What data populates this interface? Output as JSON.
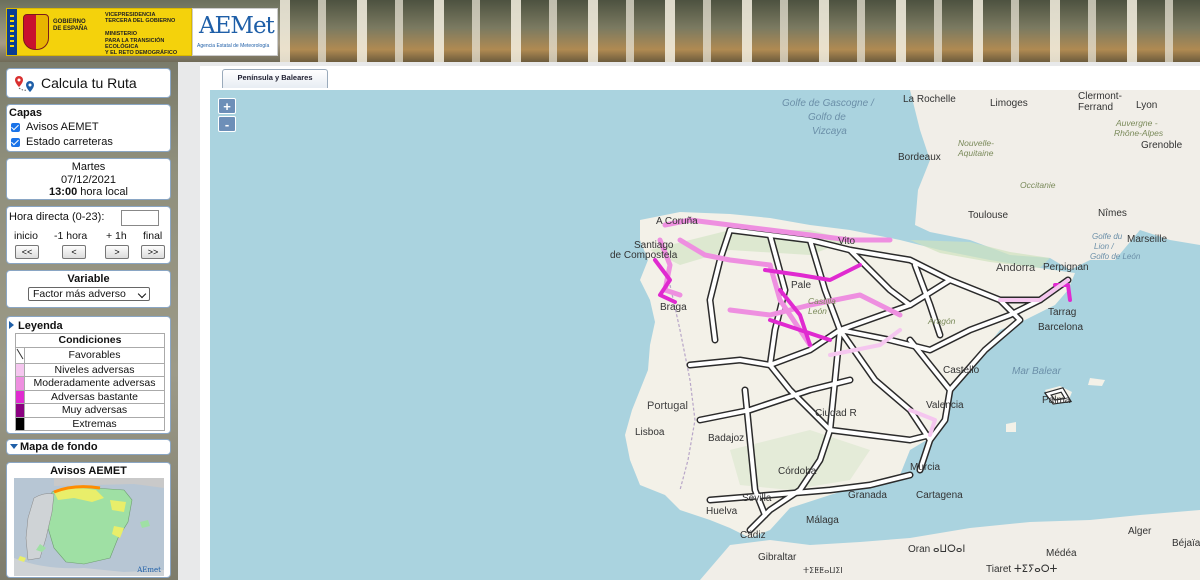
{
  "header": {
    "gov_text": "GOBIERNO\nDE ESPAÑA",
    "ministry_text": "VICEPRESIDENCIA\nTERCERA DEL GOBIERNO\n\nMINISTERIO\nPARA LA TRANSICIÓN ECOLÓGICA\nY EL RETO DEMOGRÁFICO",
    "aemet_logo": "AEMet",
    "aemet_subtitle": "Agencia Estatal de Meteorología"
  },
  "sidebar": {
    "route_title": "Calcula tu Ruta",
    "layers": {
      "title": "Capas",
      "items": [
        {
          "label": "Avisos AEMET",
          "checked": true
        },
        {
          "label": "Estado carreteras",
          "checked": true
        }
      ]
    },
    "date": {
      "day": "Martes",
      "date": "07/12/2021",
      "time": "13:00",
      "time_suffix": " hora local"
    },
    "time_nav": {
      "label": "Hora directa (0-23):",
      "input_value": "",
      "labels": [
        "inicio",
        "-1 hora",
        "+ 1h",
        "final"
      ],
      "buttons": [
        "<<",
        "<",
        ">",
        ">>"
      ]
    },
    "variable": {
      "title": "Variable",
      "selected": "Factor más adverso"
    },
    "legend": {
      "title": "Leyenda",
      "header": "Condiciones",
      "rows": [
        {
          "label": "Favorables",
          "color": "#ffffff"
        },
        {
          "label": "Niveles adversas",
          "color": "#f5c6ef"
        },
        {
          "label": "Moderadamente adversas",
          "color": "#ee8fe0"
        },
        {
          "label": "Adversas bastante",
          "color": "#e02ad0"
        },
        {
          "label": "Muy adversas",
          "color": "#8a0080"
        },
        {
          "label": "Extremas",
          "color": "#000000"
        }
      ]
    },
    "basemap_title": "Mapa de fondo",
    "avisos_title": "Avisos AEMET",
    "avisos_brand": "AEmet"
  },
  "main": {
    "tab_label": "Península y Baleares",
    "zoom_in": "+",
    "zoom_out": "-",
    "map_labels": {
      "gascogne": "Golfe de Gascogne /",
      "golfo": "Golfo de",
      "vizcaya": "Vizcaya",
      "la_rochelle": "La Rochelle",
      "limoges": "Limoges",
      "clermont": "Clermont-",
      "ferrand": "Ferrand",
      "auvergne": "Auvergne -",
      "rhone_alpes": "Rhône-Alpes",
      "lyon": "Lyon",
      "bordeaux": "Bordeaux",
      "nouvelle": "Nouvelle-",
      "aquitaine": "Aquitaine",
      "grenoble": "Grenoble",
      "toulouse": "Toulouse",
      "occitanie": "Occitanie",
      "nimes": "Nîmes",
      "marseille": "Marseille",
      "golfe_lion": "Golfe du",
      "lion": "Lion /",
      "golfo_leon": "Golfo de León",
      "andorra": "Andorra",
      "perpignan": "Perpignan",
      "coruna": "A Coruña",
      "santiago": "Santiago",
      "compostela": "de Compostela",
      "vitoria": "Vito",
      "palencia": "Pale",
      "castilla": "Castilla",
      "leon": "León",
      "braga": "Braga",
      "aragon": "Aragón",
      "barcelona": "Barcelona",
      "tarragona": "Tarrag",
      "castellon": "Castello",
      "mar_balear": "Mar Balear",
      "portugal": "Portugal",
      "lisboa": "Lisboa",
      "badajoz": "Badajoz",
      "ciudad_real": "Ciudad R",
      "valencia": "Valencia",
      "palma": "Palma",
      "cordoba": "Córdoba",
      "sevilla": "Sevilla",
      "huelva": "Huelva",
      "granada": "Granada",
      "murcia": "Murcia",
      "cartagena": "Cartagena",
      "cadiz": "Cádiz",
      "malaga": "Málaga",
      "gibraltar": "Gibraltar",
      "oran": "Oran ⴰⵡⵔⴰⵏ",
      "alger": "Alger",
      "tiaret": "Tiaret ⵜⵉⵢⴰⵔⵜ",
      "tetuan": "ⵜⵉⵟⵟⴰⵡⵉⵏ",
      "medea": "Médéa",
      "bejaia": "Béjaïa"
    }
  },
  "colors": {
    "sea": "#aad3df",
    "land": "#f2efe9",
    "favorable": "#ffffff",
    "road_outline": "#2b2b2b",
    "adverse": "#e02ad0",
    "mild": "#f0a8ea"
  }
}
